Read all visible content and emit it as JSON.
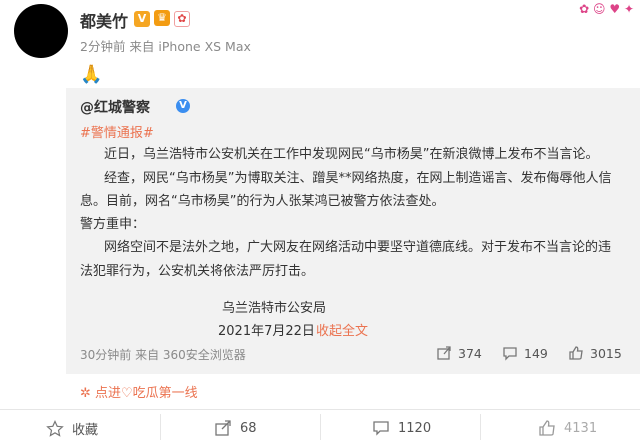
{
  "author": {
    "name": "都美竹",
    "v_badge": "V"
  },
  "post": {
    "meta": "2分钟前 来自 iPhone XS Max",
    "emoji": "🙏"
  },
  "repost": {
    "user": "@红城警察",
    "hashtag": "#警情通报#",
    "lines": [
      "近日，乌兰浩特市公安机关在工作中发现网民“乌市杨昊”在新浪微博上发布不当言论。",
      "经查，网民“乌市杨昊”为博取关注、蹭昊**网络热度，在网上制造谣言、发布侮辱他人信",
      "息。目前，网名“乌市杨昊”的行为人张某鸿已被警方依法查处。",
      "警方重申：",
      "网络空间不是法外之地，广大网友在网络活动中要坚守道德底线。对于发布不当言论的违",
      "法犯罪行为，公安机关将依法严厉打击。",
      "乌兰浩特市公安局"
    ],
    "date": "2021年7月22日",
    "collapse": "收起全文",
    "meta": "30分钟前 来自 360安全浏览器",
    "stats": {
      "repost": "374",
      "comment": "149",
      "like": "3015"
    }
  },
  "like_line": "点进♡吃瓜第一线",
  "bottom": {
    "collect": "收藏",
    "repost": "68",
    "comment": "1120",
    "like": "4131"
  }
}
